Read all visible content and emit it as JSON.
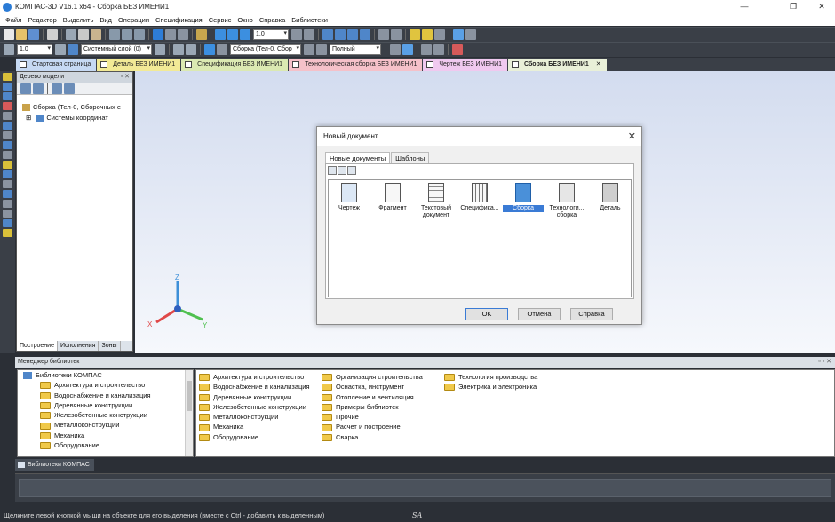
{
  "window": {
    "title": "КОМПАС-3D V16.1 x64 - Сборка БЕЗ ИМЕНИ1",
    "min": "—",
    "max": "❐",
    "close": "✕"
  },
  "menu": [
    "Файл",
    "Редактор",
    "Выделить",
    "Вид",
    "Операции",
    "Спецификация",
    "Сервис",
    "Окно",
    "Справка",
    "Библиотеки"
  ],
  "toolbar1": {
    "zoom_value": "1.0"
  },
  "toolbar2": {
    "scale_value": "1.0",
    "layer": "Системный слой (0)",
    "component": "Сборка (Тел-0, Сбор",
    "view_mode": "Полный"
  },
  "tabs": [
    {
      "label": "Стартовая страница",
      "color": "#c6d9f3"
    },
    {
      "label": "Деталь БЕЗ ИМЕНИ1",
      "color": "#f2ea96"
    },
    {
      "label": "Спецификация БЕЗ ИМЕНИ1",
      "color": "#dbe9b2"
    },
    {
      "label": "Технологическая сборка БЕЗ ИМЕНИ1",
      "color": "#f5c1c9"
    },
    {
      "label": "Чертеж БЕЗ ИМЕНИ1",
      "color": "#f0c9ef"
    },
    {
      "label": "Сборка БЕЗ ИМЕНИ1",
      "color": "#e9f0d8",
      "close": "✕"
    }
  ],
  "tree": {
    "title": "Дерево модели",
    "root": "Сборка (Тел-0, Сборочных е",
    "child": "Системы координат",
    "expander": "⊞",
    "bottom_tabs": [
      "Построение",
      "Исполнения",
      "Зоны"
    ]
  },
  "axes": {
    "x": "X",
    "y": "Y",
    "z": "Z"
  },
  "dialog": {
    "title": "Новый документ",
    "close": "✕",
    "tabs": [
      "Новые документы",
      "Шаблоны"
    ],
    "items": [
      "Чертеж",
      "Фрагмент",
      "Текстовый документ",
      "Специфика...",
      "Сборка",
      "Технологи... сборка",
      "Деталь"
    ],
    "selected": "Сборка",
    "ok": "OK",
    "cancel": "Отмена",
    "help": "Справка"
  },
  "library": {
    "title": "Менеджер библиотек",
    "root": "Библиотеки КОМПАС",
    "tree": [
      "Архитектура и строительство",
      "Водоснабжение и канализация",
      "Деревянные конструкции",
      "Железобетонные конструкции",
      "Металлоконструкции",
      "Механика",
      "Оборудование"
    ],
    "col1": [
      "Архитектура и строительство",
      "Водоснабжение и канализация",
      "Деревянные конструкции",
      "Железобетонные конструкции",
      "Металлоконструкции",
      "Механика",
      "Оборудование"
    ],
    "col2": [
      "Организация строительства",
      "Оснастка, инструмент",
      "Отопление и вентиляция",
      "Примеры библиотек",
      "Прочие",
      "Расчет и построение",
      "Сварка"
    ],
    "col3": [
      "Технология производства",
      "Электрика и электроника"
    ],
    "tab": "Библиотеки КОМПАС"
  },
  "status": {
    "text": "Щелкните левой кнопкой мыши на объекте для его выделения (вместе с Ctrl - добавить к выделенным)",
    "sa": "SA"
  }
}
